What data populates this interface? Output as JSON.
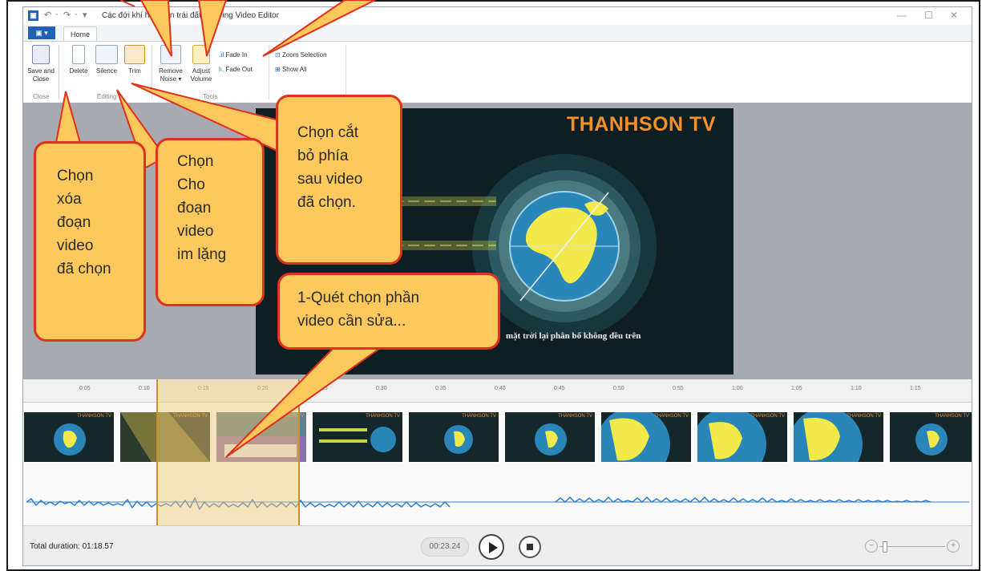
{
  "window": {
    "title": "Các đới khí hậu trên trái đất - iSpring Video Editor",
    "qat": [
      "↶",
      "·",
      "↷",
      "·",
      "▾"
    ],
    "controls": [
      "—",
      "☐",
      "✕"
    ]
  },
  "tabs": {
    "file": "▣ ▾",
    "home": "Home"
  },
  "ribbon": {
    "save_close": [
      "Save and",
      "Close"
    ],
    "delete": "Delete",
    "silence": "Silence",
    "trim": "Trim",
    "remove_noise": [
      "Remove",
      "Noise ▾"
    ],
    "adjust_volume": [
      "Adjust",
      "Volume"
    ],
    "fade_in": "Fade In",
    "fade_out": "Fade Out",
    "zoom_selection": "Zoom Selection",
    "show_all": "Show All",
    "groups": {
      "close": "Close",
      "editing": "Editing",
      "tools": "Tools"
    }
  },
  "preview": {
    "brand": "THANHSON TV",
    "caption": "mặt trời lại phân bố không đều trên"
  },
  "timeline": {
    "ticks": [
      "0:05",
      "0:10",
      "0:15",
      "0:20",
      "0:25",
      "0:30",
      "0:35",
      "0:40",
      "0:45",
      "0:50",
      "0:55",
      "1:00",
      "1:05",
      "1:10",
      "1:15"
    ],
    "thumb_label": "THANHSON TV"
  },
  "player": {
    "total_duration": "Total duration: 01:18.57",
    "timecode": "00:23.24",
    "zoom_minus": "−",
    "zoom_plus": "+"
  },
  "callouts": {
    "delete": [
      "Chọn",
      "xóa",
      "đoạn",
      "video",
      "đã chọn"
    ],
    "silence": [
      "Chọn",
      "Cho",
      "đoạn",
      "video",
      "im lặng"
    ],
    "trim": [
      "Chọn cắt",
      "bỏ phía",
      "sau video",
      "đã chọn."
    ],
    "select": [
      "1-Quét chọn phần",
      "video cần sửa..."
    ]
  },
  "colors": {
    "callout_fill": "#fdc95d",
    "callout_border": "#e0301e",
    "accent_blue": "#1f62b5",
    "brand_orange": "#f4902a"
  }
}
